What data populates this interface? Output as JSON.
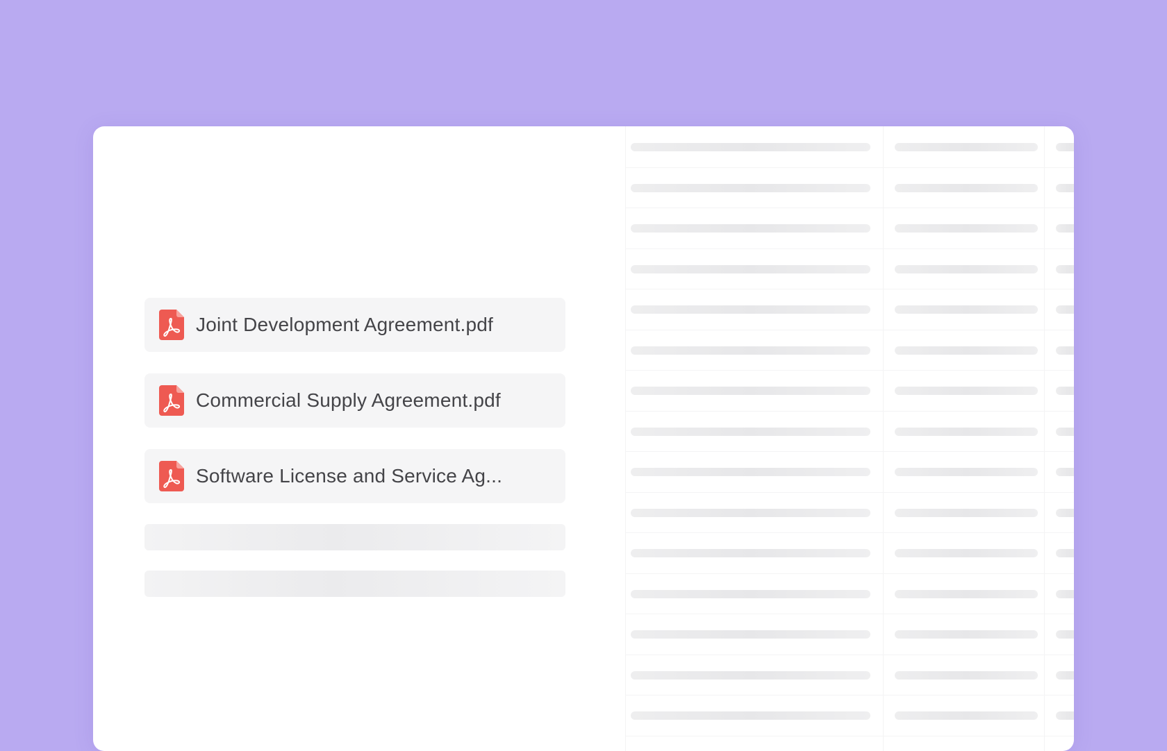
{
  "files": [
    {
      "name": "Joint Development Agreement.pdf",
      "icon": "pdf-icon"
    },
    {
      "name": "Commercial Supply Agreement.pdf",
      "icon": "pdf-icon"
    },
    {
      "name": "Software License and Service Ag...",
      "icon": "pdf-icon"
    }
  ],
  "colors": {
    "background": "#b9aaf1",
    "card": "#ffffff",
    "pdf_red": "#ee5a52",
    "file_item_bg": "#f5f5f6",
    "text": "#444448"
  }
}
